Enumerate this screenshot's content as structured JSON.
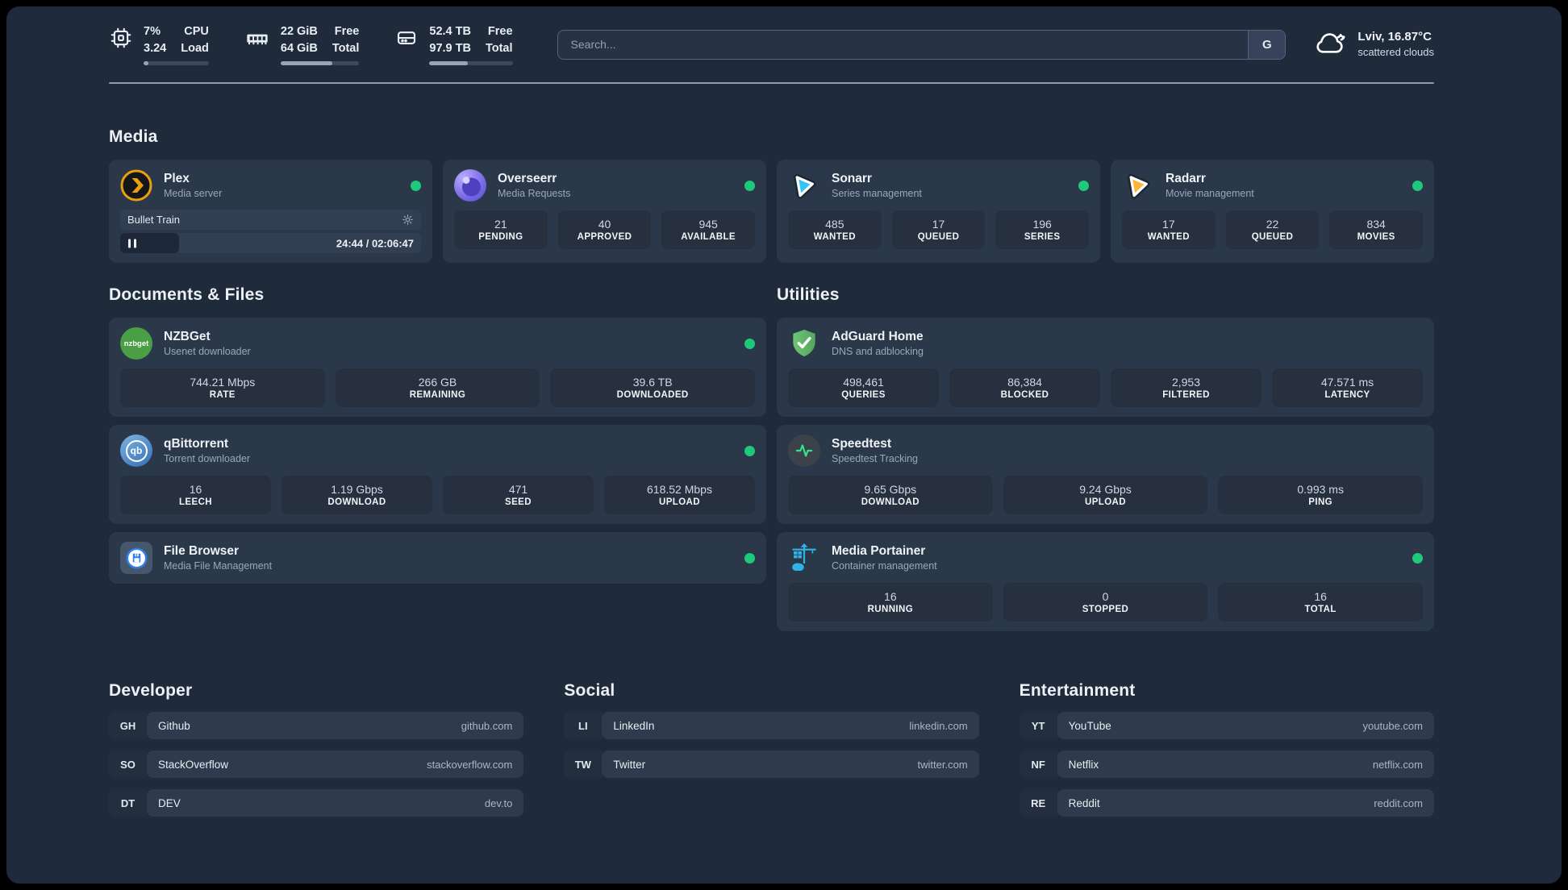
{
  "header": {
    "system_stats": [
      {
        "icon": "cpu-icon",
        "values": [
          "7%",
          "3.24"
        ],
        "labels": [
          "CPU",
          "Load"
        ],
        "progress_pct": 7
      },
      {
        "icon": "ram-icon",
        "values": [
          "22 GiB",
          "64 GiB"
        ],
        "labels": [
          "Free",
          "Total"
        ],
        "progress_pct": 66
      },
      {
        "icon": "disk-icon",
        "values": [
          "52.4 TB",
          "97.9 TB"
        ],
        "labels": [
          "Free",
          "Total"
        ],
        "progress_pct": 46
      }
    ],
    "search": {
      "placeholder": "Search...",
      "engine_button": "G"
    },
    "weather": {
      "icon": "cloud-icon",
      "location_temp": "Lviv, 16.87°C",
      "condition": "scattered clouds"
    }
  },
  "sections": {
    "media": {
      "title": "Media",
      "plex": {
        "name": "Plex",
        "subtitle": "Media server",
        "status": "online",
        "player": {
          "title": "Bullet Train",
          "time": "24:44 / 02:06:47",
          "progress_pct": 19.5
        }
      },
      "overseerr": {
        "name": "Overseerr",
        "subtitle": "Media Requests",
        "status": "online",
        "stats": [
          {
            "value": "21",
            "label": "PENDING"
          },
          {
            "value": "40",
            "label": "APPROVED"
          },
          {
            "value": "945",
            "label": "AVAILABLE"
          }
        ]
      },
      "sonarr": {
        "name": "Sonarr",
        "subtitle": "Series management",
        "status": "online",
        "stats": [
          {
            "value": "485",
            "label": "WANTED"
          },
          {
            "value": "17",
            "label": "QUEUED"
          },
          {
            "value": "196",
            "label": "SERIES"
          }
        ]
      },
      "radarr": {
        "name": "Radarr",
        "subtitle": "Movie management",
        "status": "online",
        "stats": [
          {
            "value": "17",
            "label": "WANTED"
          },
          {
            "value": "22",
            "label": "QUEUED"
          },
          {
            "value": "834",
            "label": "MOVIES"
          }
        ]
      }
    },
    "documents": {
      "title": "Documents & Files",
      "nzbget": {
        "name": "NZBGet",
        "subtitle": "Usenet downloader",
        "status": "online",
        "stats": [
          {
            "value": "744.21 Mbps",
            "label": "RATE"
          },
          {
            "value": "266 GB",
            "label": "REMAINING"
          },
          {
            "value": "39.6 TB",
            "label": "DOWNLOADED"
          }
        ]
      },
      "qbittorrent": {
        "name": "qBittorrent",
        "subtitle": "Torrent downloader",
        "status": "online",
        "stats": [
          {
            "value": "16",
            "label": "LEECH"
          },
          {
            "value": "1.19 Gbps",
            "label": "DOWNLOAD"
          },
          {
            "value": "471",
            "label": "SEED"
          },
          {
            "value": "618.52 Mbps",
            "label": "UPLOAD"
          }
        ]
      },
      "filebrowser": {
        "name": "File Browser",
        "subtitle": "Media File Management",
        "status": "online"
      }
    },
    "utilities": {
      "title": "Utilities",
      "adguard": {
        "name": "AdGuard Home",
        "subtitle": "DNS and adblocking",
        "stats": [
          {
            "value": "498,461",
            "label": "QUERIES"
          },
          {
            "value": "86,384",
            "label": "BLOCKED"
          },
          {
            "value": "2,953",
            "label": "FILTERED"
          },
          {
            "value": "47.571 ms",
            "label": "LATENCY"
          }
        ]
      },
      "speedtest": {
        "name": "Speedtest",
        "subtitle": "Speedtest Tracking",
        "stats": [
          {
            "value": "9.65 Gbps",
            "label": "DOWNLOAD"
          },
          {
            "value": "9.24 Gbps",
            "label": "UPLOAD"
          },
          {
            "value": "0.993 ms",
            "label": "PING"
          }
        ]
      },
      "portainer": {
        "name": "Media Portainer",
        "subtitle": "Container management",
        "status": "online",
        "stats": [
          {
            "value": "16",
            "label": "RUNNING"
          },
          {
            "value": "0",
            "label": "STOPPED"
          },
          {
            "value": "16",
            "label": "TOTAL"
          }
        ]
      }
    },
    "developer": {
      "title": "Developer",
      "links": [
        {
          "abbr": "GH",
          "name": "Github",
          "url": "github.com"
        },
        {
          "abbr": "SO",
          "name": "StackOverflow",
          "url": "stackoverflow.com"
        },
        {
          "abbr": "DT",
          "name": "DEV",
          "url": "dev.to"
        }
      ]
    },
    "social": {
      "title": "Social",
      "links": [
        {
          "abbr": "LI",
          "name": "LinkedIn",
          "url": "linkedin.com"
        },
        {
          "abbr": "TW",
          "name": "Twitter",
          "url": "twitter.com"
        }
      ]
    },
    "entertainment": {
      "title": "Entertainment",
      "links": [
        {
          "abbr": "YT",
          "name": "YouTube",
          "url": "youtube.com"
        },
        {
          "abbr": "NF",
          "name": "Netflix",
          "url": "netflix.com"
        },
        {
          "abbr": "RE",
          "name": "Reddit",
          "url": "reddit.com"
        }
      ]
    }
  },
  "colors": {
    "status_online": "#1ec97c",
    "page_bg": "#1f2a3b",
    "card_bg": "#2b3849",
    "tile_bg": "#26303f",
    "accent_plex": "#e8a00d",
    "accent_overseerr": "#7b6cdf",
    "accent_sonarr": "#35c5f4",
    "accent_radarr": "#ffb53a",
    "accent_nzbget": "#4a9e44",
    "accent_qbittorrent": "#4285c7",
    "accent_filebrowser": "#2f80ed",
    "accent_adguard": "#63b56b",
    "accent_speedtest": "#35e08e",
    "accent_portainer": "#2fb2e6"
  }
}
